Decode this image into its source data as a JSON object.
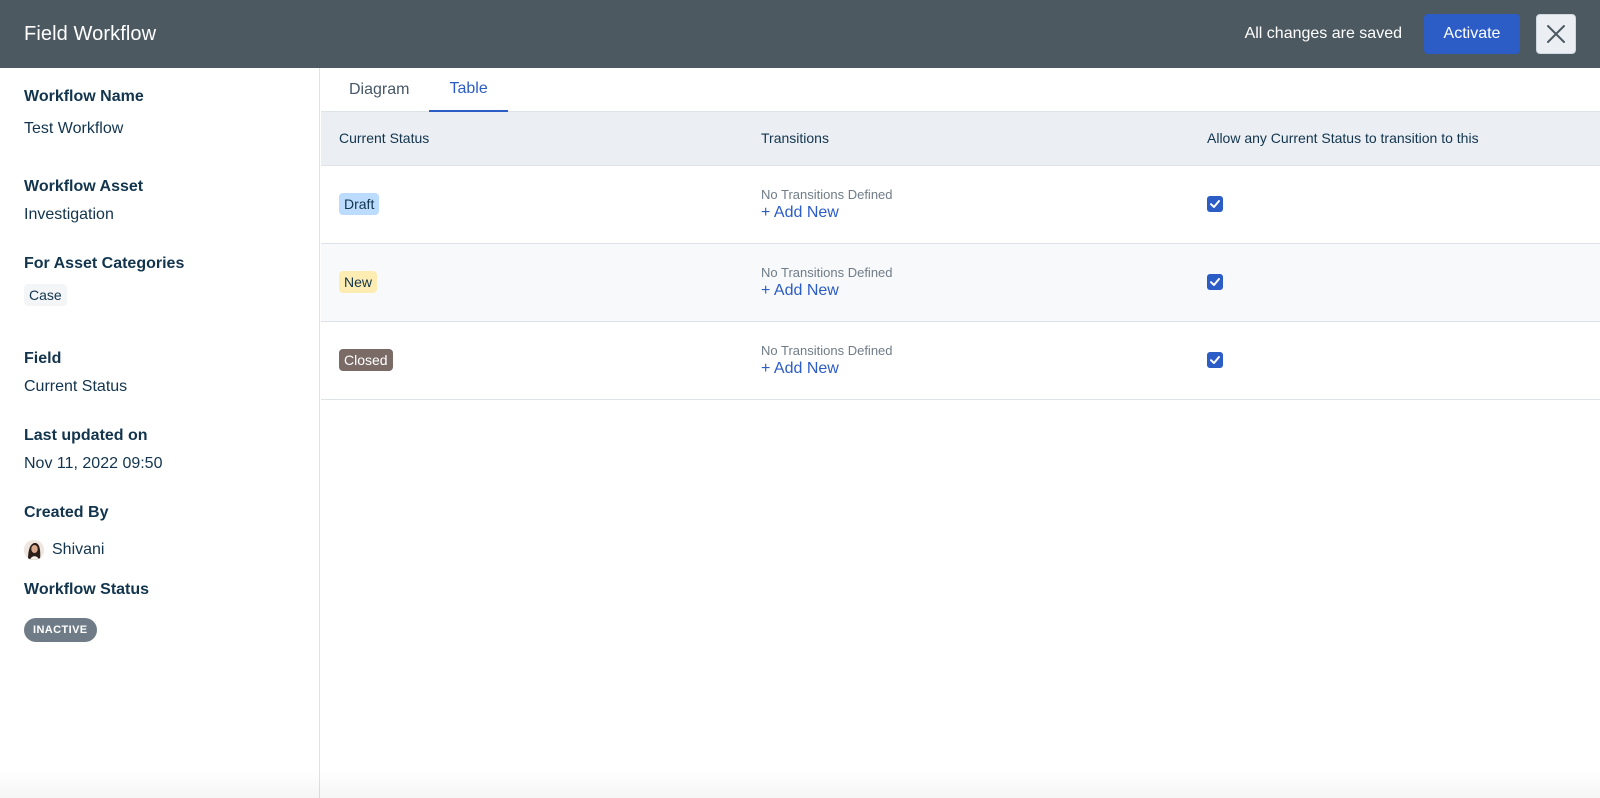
{
  "header": {
    "title": "Field Workflow",
    "save_status": "All changes are saved",
    "activate_label": "Activate",
    "close_icon": "close-icon"
  },
  "details": {
    "workflow_name_label": "Workflow Name",
    "workflow_name": "Test Workflow",
    "workflow_asset_label": "Workflow Asset",
    "workflow_asset": "Investigation",
    "asset_categories_label": "For Asset Categories",
    "asset_categories": [
      "Case"
    ],
    "field_label": "Field",
    "field_value": "Current Status",
    "last_updated_label": "Last updated on",
    "last_updated": "Nov 11, 2022 09:50",
    "created_by_label": "Created By",
    "created_by": "Shivani",
    "workflow_status_label": "Workflow Status",
    "workflow_status": "INACTIVE"
  },
  "tabs": [
    {
      "label": "Diagram",
      "active": false
    },
    {
      "label": "Table",
      "active": true
    }
  ],
  "table": {
    "columns": [
      "Current Status",
      "Transitions",
      "Allow any Current Status to transition to this"
    ],
    "rows": [
      {
        "status": "Draft",
        "status_bg": "#bbdcfe",
        "status_fg": "#12344d",
        "transitions": "No Transitions Defined",
        "add_label": "+ Add New",
        "allow_any": true
      },
      {
        "status": "New",
        "status_bg": "#fdedb3",
        "status_fg": "#12344d",
        "transitions": "No Transitions Defined",
        "add_label": "+ Add New",
        "allow_any": true
      },
      {
        "status": "Closed",
        "status_bg": "#7b6b67",
        "status_fg": "#ffffff",
        "transitions": "No Transitions Defined",
        "add_label": "+ Add New",
        "allow_any": true
      }
    ]
  },
  "colors": {
    "header_bg": "#4c5961",
    "accent": "#2c5cc5",
    "inactive_badge": "#6f7c87"
  }
}
